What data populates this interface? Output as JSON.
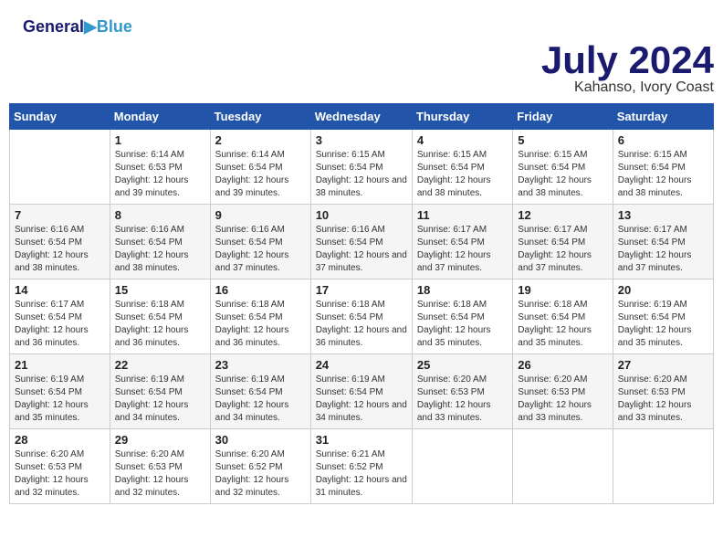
{
  "header": {
    "logo_line1": "General",
    "logo_line2": "Blue",
    "month_title": "July 2024",
    "location": "Kahanso, Ivory Coast"
  },
  "days": [
    "Sunday",
    "Monday",
    "Tuesday",
    "Wednesday",
    "Thursday",
    "Friday",
    "Saturday"
  ],
  "weeks": [
    [
      {
        "date": "",
        "sunrise": "",
        "sunset": "",
        "daylight": ""
      },
      {
        "date": "1",
        "sunrise": "Sunrise: 6:14 AM",
        "sunset": "Sunset: 6:53 PM",
        "daylight": "Daylight: 12 hours and 39 minutes."
      },
      {
        "date": "2",
        "sunrise": "Sunrise: 6:14 AM",
        "sunset": "Sunset: 6:54 PM",
        "daylight": "Daylight: 12 hours and 39 minutes."
      },
      {
        "date": "3",
        "sunrise": "Sunrise: 6:15 AM",
        "sunset": "Sunset: 6:54 PM",
        "daylight": "Daylight: 12 hours and 38 minutes."
      },
      {
        "date": "4",
        "sunrise": "Sunrise: 6:15 AM",
        "sunset": "Sunset: 6:54 PM",
        "daylight": "Daylight: 12 hours and 38 minutes."
      },
      {
        "date": "5",
        "sunrise": "Sunrise: 6:15 AM",
        "sunset": "Sunset: 6:54 PM",
        "daylight": "Daylight: 12 hours and 38 minutes."
      },
      {
        "date": "6",
        "sunrise": "Sunrise: 6:15 AM",
        "sunset": "Sunset: 6:54 PM",
        "daylight": "Daylight: 12 hours and 38 minutes."
      }
    ],
    [
      {
        "date": "7",
        "sunrise": "Sunrise: 6:16 AM",
        "sunset": "Sunset: 6:54 PM",
        "daylight": "Daylight: 12 hours and 38 minutes."
      },
      {
        "date": "8",
        "sunrise": "Sunrise: 6:16 AM",
        "sunset": "Sunset: 6:54 PM",
        "daylight": "Daylight: 12 hours and 38 minutes."
      },
      {
        "date": "9",
        "sunrise": "Sunrise: 6:16 AM",
        "sunset": "Sunset: 6:54 PM",
        "daylight": "Daylight: 12 hours and 37 minutes."
      },
      {
        "date": "10",
        "sunrise": "Sunrise: 6:16 AM",
        "sunset": "Sunset: 6:54 PM",
        "daylight": "Daylight: 12 hours and 37 minutes."
      },
      {
        "date": "11",
        "sunrise": "Sunrise: 6:17 AM",
        "sunset": "Sunset: 6:54 PM",
        "daylight": "Daylight: 12 hours and 37 minutes."
      },
      {
        "date": "12",
        "sunrise": "Sunrise: 6:17 AM",
        "sunset": "Sunset: 6:54 PM",
        "daylight": "Daylight: 12 hours and 37 minutes."
      },
      {
        "date": "13",
        "sunrise": "Sunrise: 6:17 AM",
        "sunset": "Sunset: 6:54 PM",
        "daylight": "Daylight: 12 hours and 37 minutes."
      }
    ],
    [
      {
        "date": "14",
        "sunrise": "Sunrise: 6:17 AM",
        "sunset": "Sunset: 6:54 PM",
        "daylight": "Daylight: 12 hours and 36 minutes."
      },
      {
        "date": "15",
        "sunrise": "Sunrise: 6:18 AM",
        "sunset": "Sunset: 6:54 PM",
        "daylight": "Daylight: 12 hours and 36 minutes."
      },
      {
        "date": "16",
        "sunrise": "Sunrise: 6:18 AM",
        "sunset": "Sunset: 6:54 PM",
        "daylight": "Daylight: 12 hours and 36 minutes."
      },
      {
        "date": "17",
        "sunrise": "Sunrise: 6:18 AM",
        "sunset": "Sunset: 6:54 PM",
        "daylight": "Daylight: 12 hours and 36 minutes."
      },
      {
        "date": "18",
        "sunrise": "Sunrise: 6:18 AM",
        "sunset": "Sunset: 6:54 PM",
        "daylight": "Daylight: 12 hours and 35 minutes."
      },
      {
        "date": "19",
        "sunrise": "Sunrise: 6:18 AM",
        "sunset": "Sunset: 6:54 PM",
        "daylight": "Daylight: 12 hours and 35 minutes."
      },
      {
        "date": "20",
        "sunrise": "Sunrise: 6:19 AM",
        "sunset": "Sunset: 6:54 PM",
        "daylight": "Daylight: 12 hours and 35 minutes."
      }
    ],
    [
      {
        "date": "21",
        "sunrise": "Sunrise: 6:19 AM",
        "sunset": "Sunset: 6:54 PM",
        "daylight": "Daylight: 12 hours and 35 minutes."
      },
      {
        "date": "22",
        "sunrise": "Sunrise: 6:19 AM",
        "sunset": "Sunset: 6:54 PM",
        "daylight": "Daylight: 12 hours and 34 minutes."
      },
      {
        "date": "23",
        "sunrise": "Sunrise: 6:19 AM",
        "sunset": "Sunset: 6:54 PM",
        "daylight": "Daylight: 12 hours and 34 minutes."
      },
      {
        "date": "24",
        "sunrise": "Sunrise: 6:19 AM",
        "sunset": "Sunset: 6:54 PM",
        "daylight": "Daylight: 12 hours and 34 minutes."
      },
      {
        "date": "25",
        "sunrise": "Sunrise: 6:20 AM",
        "sunset": "Sunset: 6:53 PM",
        "daylight": "Daylight: 12 hours and 33 minutes."
      },
      {
        "date": "26",
        "sunrise": "Sunrise: 6:20 AM",
        "sunset": "Sunset: 6:53 PM",
        "daylight": "Daylight: 12 hours and 33 minutes."
      },
      {
        "date": "27",
        "sunrise": "Sunrise: 6:20 AM",
        "sunset": "Sunset: 6:53 PM",
        "daylight": "Daylight: 12 hours and 33 minutes."
      }
    ],
    [
      {
        "date": "28",
        "sunrise": "Sunrise: 6:20 AM",
        "sunset": "Sunset: 6:53 PM",
        "daylight": "Daylight: 12 hours and 32 minutes."
      },
      {
        "date": "29",
        "sunrise": "Sunrise: 6:20 AM",
        "sunset": "Sunset: 6:53 PM",
        "daylight": "Daylight: 12 hours and 32 minutes."
      },
      {
        "date": "30",
        "sunrise": "Sunrise: 6:20 AM",
        "sunset": "Sunset: 6:52 PM",
        "daylight": "Daylight: 12 hours and 32 minutes."
      },
      {
        "date": "31",
        "sunrise": "Sunrise: 6:21 AM",
        "sunset": "Sunset: 6:52 PM",
        "daylight": "Daylight: 12 hours and 31 minutes."
      },
      {
        "date": "",
        "sunrise": "",
        "sunset": "",
        "daylight": ""
      },
      {
        "date": "",
        "sunrise": "",
        "sunset": "",
        "daylight": ""
      },
      {
        "date": "",
        "sunrise": "",
        "sunset": "",
        "daylight": ""
      }
    ]
  ]
}
